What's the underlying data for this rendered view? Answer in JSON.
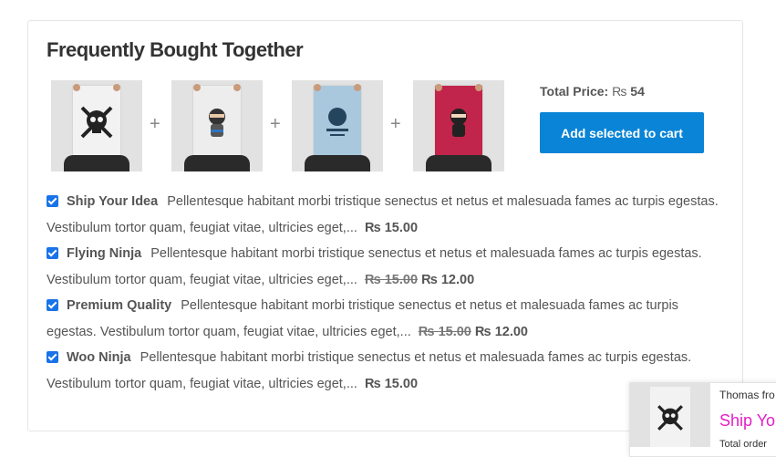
{
  "section": {
    "title": "Frequently Bought Together"
  },
  "products": [
    {
      "name": "Ship Your Idea",
      "icon": "skull-poster-icon",
      "color": "#f2f2f2"
    },
    {
      "name": "Flying Ninja",
      "icon": "ninja-poster-icon",
      "color": "#ededed"
    },
    {
      "name": "Premium Quality",
      "icon": "premium-poster-icon",
      "color": "#a9c8dd"
    },
    {
      "name": "Woo Ninja",
      "icon": "ninja-poster-icon",
      "color": "#c2254b"
    }
  ],
  "plus_symbol": "+",
  "total": {
    "label": "Total Price:",
    "currency": "₨",
    "amount": "54"
  },
  "cart_button": {
    "label": "Add selected to cart",
    "color": "#0a84d6"
  },
  "items": [
    {
      "checked": true,
      "name": "Ship Your Idea",
      "desc": "Pellentesque habitant morbi tristique senectus et netus et malesuada fames ac turpis egestas. Vestibulum tortor quam, feugiat vitae, ultricies eget,...",
      "old_price": "",
      "price": "₨ 15.00"
    },
    {
      "checked": true,
      "name": "Flying Ninja",
      "desc": "Pellentesque habitant morbi tristique senectus et netus et malesuada fames ac turpis egestas. Vestibulum tortor quam, feugiat vitae, ultricies eget,...",
      "old_price": "₨ 15.00",
      "price": "₨ 12.00"
    },
    {
      "checked": true,
      "name": "Premium Quality",
      "desc": "Pellentesque habitant morbi tristique senectus et netus et malesuada fames ac turpis egestas. Vestibulum tortor quam, feugiat vitae, ultricies eget,...",
      "old_price": "₨ 15.00",
      "price": "₨ 12.00"
    },
    {
      "checked": true,
      "name": "Woo Ninja",
      "desc": "Pellentesque habitant morbi tristique senectus et netus et malesuada fames ac turpis egestas. Vestibulum tortor quam, feugiat vitae, ultricies eget,...",
      "old_price": "",
      "price": "₨ 15.00"
    }
  ],
  "toast": {
    "line1": "Thomas fro",
    "line2": "Ship You",
    "line3": "Total order",
    "icon": "skull-poster-icon",
    "accent": "#e51ec7"
  }
}
